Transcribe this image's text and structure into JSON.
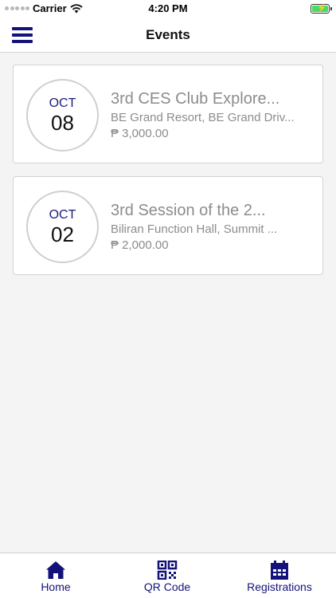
{
  "status_bar": {
    "carrier": "Carrier",
    "time": "4:20 PM",
    "battery_color": "#4cd964"
  },
  "nav": {
    "title": "Events",
    "menu_icon": "hamburger-menu-icon"
  },
  "events": [
    {
      "month": "OCT",
      "day": "08",
      "title": "3rd CES Club Explore...",
      "location": "BE Grand Resort, BE Grand Driv...",
      "price": "₱ 3,000.00"
    },
    {
      "month": "OCT",
      "day": "02",
      "title": "3rd Session of the 2...",
      "location": "Biliran Function Hall, Summit ...",
      "price": "₱ 2,000.00"
    }
  ],
  "tab_bar": {
    "home_label": "Home",
    "qr_label": "QR Code",
    "registrations_label": "Registrations",
    "accent_color": "#12127a"
  }
}
